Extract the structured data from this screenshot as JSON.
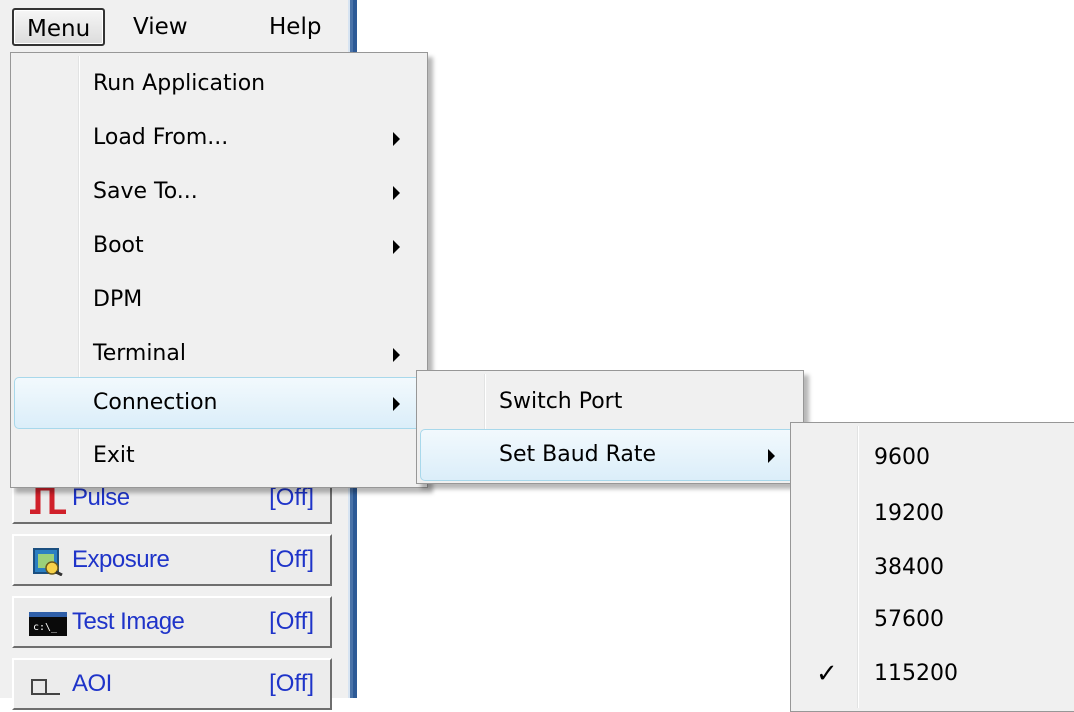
{
  "menubar": {
    "items": [
      {
        "label": "Menu",
        "active": true
      },
      {
        "label": "View",
        "active": false
      },
      {
        "label": "Help",
        "active": false
      }
    ]
  },
  "main_menu": {
    "items": [
      {
        "label": "Run Application",
        "submenu": false
      },
      {
        "label": "Load From...",
        "submenu": true
      },
      {
        "label": "Save To...",
        "submenu": true
      },
      {
        "label": "Boot",
        "submenu": true
      },
      {
        "label": "DPM",
        "submenu": false
      },
      {
        "label": "Terminal",
        "submenu": true
      },
      {
        "label": "Connection",
        "submenu": true,
        "highlighted": true
      },
      {
        "label": "Exit",
        "submenu": false
      }
    ]
  },
  "connection_menu": {
    "items": [
      {
        "label": "Switch Port",
        "submenu": false
      },
      {
        "label": "Set Baud Rate",
        "submenu": true,
        "highlighted": true
      }
    ]
  },
  "baud_menu": {
    "items": [
      {
        "label": "9600",
        "checked": false
      },
      {
        "label": "19200",
        "checked": false
      },
      {
        "label": "38400",
        "checked": false
      },
      {
        "label": "57600",
        "checked": false
      },
      {
        "label": "115200",
        "checked": true
      }
    ],
    "check_glyph": "✓"
  },
  "panel": {
    "buttons": [
      {
        "label": "Pulse",
        "state": "[Off]",
        "icon": "pulse-icon"
      },
      {
        "label": "Exposure",
        "state": "[Off]",
        "icon": "exposure-icon"
      },
      {
        "label": "Test Image",
        "state": "[Off]",
        "icon": "test-image-icon"
      },
      {
        "label": "AOI",
        "state": "[Off]",
        "icon": "aoi-icon"
      }
    ]
  },
  "colors": {
    "panel_text": "#1f34c9",
    "highlight_border": "#a8d8eb",
    "menu_bg": "#f0f0f0"
  }
}
